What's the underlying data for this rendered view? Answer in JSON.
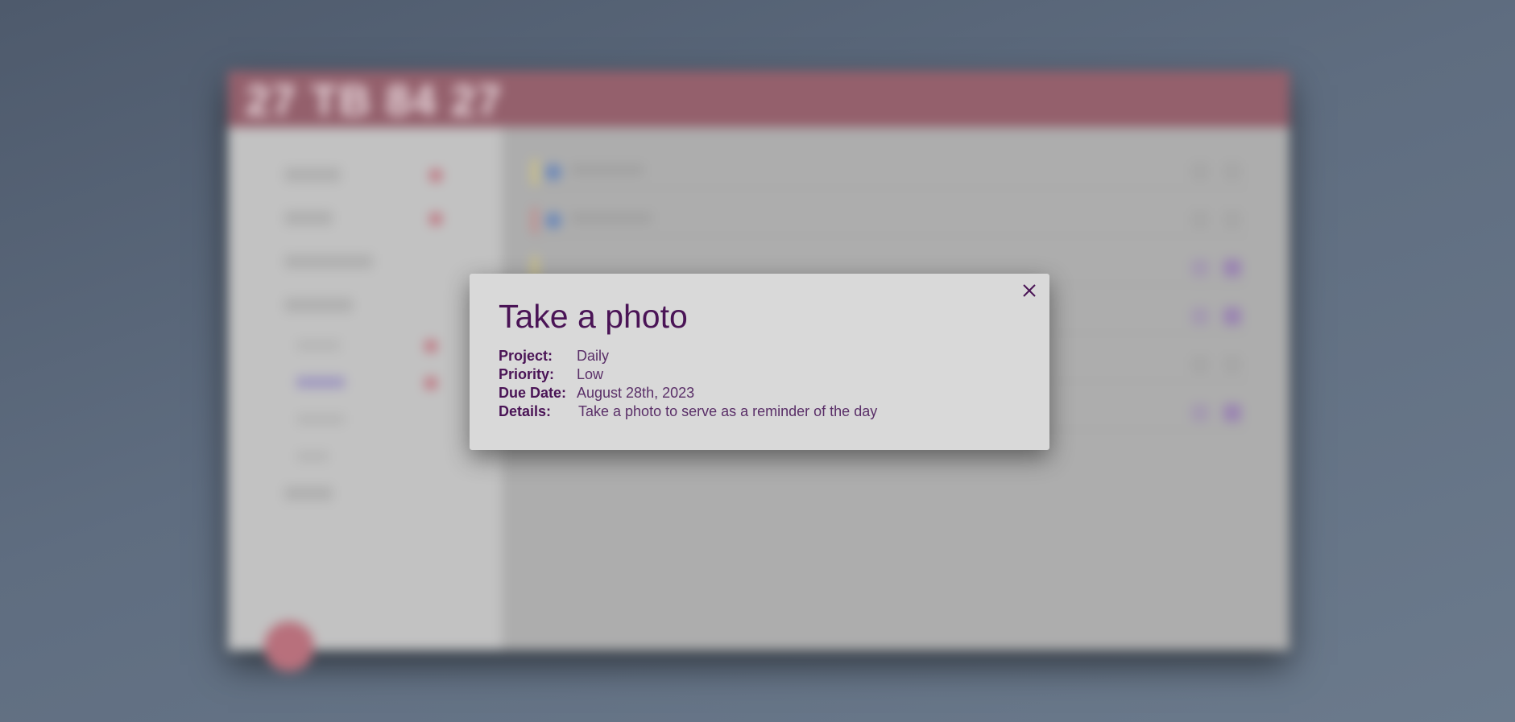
{
  "background": {
    "app_title": "27 TB 84 27"
  },
  "modal": {
    "title": "Take a photo",
    "close_label": "close",
    "details": {
      "project_label": "Project:",
      "project_value": "Daily",
      "priority_label": "Priority:",
      "priority_value": "Low",
      "due_label": "Due Date:",
      "due_value": "August 28th, 2023",
      "details_label": "Details:",
      "details_value": "Take a photo to serve as a reminder of the day"
    }
  },
  "colors": {
    "modal_text": "#4a1456",
    "modal_bg": "#d9d9d9",
    "header": "#94606c",
    "accent_dot": "#c0727e"
  }
}
